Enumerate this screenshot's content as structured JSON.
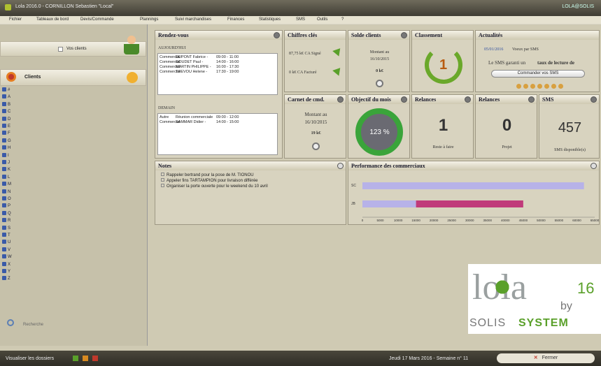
{
  "window": {
    "title": "Lola 2016.0 - CORNILLON Sebastien \"Local\"",
    "user": "LOLA@SOLIS"
  },
  "menu": [
    "Fichier",
    "Tableaux de bord",
    "Devis/Commande",
    "Plannings",
    "Suivi marchandises",
    "Finances",
    "Statistiques",
    "SMS",
    "Outils",
    "?"
  ],
  "sidebar": {
    "viz_label": "Vos clients",
    "clients_label": "Clients",
    "search_placeholder": "Recherche",
    "letters": [
      "#",
      "A",
      "B",
      "C",
      "D",
      "E",
      "F",
      "G",
      "H",
      "I",
      "J",
      "K",
      "L",
      "M",
      "N",
      "O",
      "P",
      "Q",
      "R",
      "S",
      "T",
      "U",
      "V",
      "W",
      "X",
      "Y",
      "Z"
    ]
  },
  "rdv": {
    "title": "Rendez-vous",
    "today": "AUJOURD'HUI",
    "tomorrow": "DEMAIN",
    "today_rows": [
      [
        "Commercial",
        "DUPONT Fabrice -",
        "09:00 - 11:00"
      ],
      [
        "Commercial",
        "GOUDET Paul -",
        "14:00 - 16:00"
      ],
      [
        "Commercial",
        "MARTIN PHILIPPE -",
        "16:00 - 17:30"
      ],
      [
        "Commercial",
        "THEVOU Helene -",
        "17:30 - 19:00"
      ]
    ],
    "tomorrow_rows": [
      [
        "Autre",
        "Réunion commerciale",
        "09:00 - 12:00"
      ],
      [
        "Commercial",
        "SAMMAR Didier -",
        "14:00 - 15:00"
      ]
    ]
  },
  "chiffres": {
    "title": "Chiffres clés",
    "signed": "87,75 k€ CA Signé",
    "billed": "0 k€ CA Facturé"
  },
  "solde": {
    "title": "Solde clients",
    "line1": "Montant au",
    "line2": "16/10/2015",
    "value": "0 k€"
  },
  "classement": {
    "title": "Classement",
    "rank": "1"
  },
  "actu": {
    "title": "Actualités",
    "date": "05/01/2016",
    "headline": "Voeux par SMS",
    "text1": "Le SMS garanti un",
    "text2": "taux de lecture de",
    "button": "Commander vos SMS"
  },
  "carnet": {
    "title": "Carnet de cmd.",
    "line1": "Montant au",
    "line2": "16/10/2015",
    "value": "19 k€"
  },
  "objectif": {
    "title": "Objectif du mois",
    "value": "123 %"
  },
  "relances1": {
    "title": "Relances",
    "value": "1",
    "label": "Reste à faire"
  },
  "relances2": {
    "title": "Relances",
    "value": "0",
    "label": "Projet"
  },
  "sms": {
    "title": "SMS",
    "value": "457",
    "label": "SMS disponible(s)"
  },
  "notes": {
    "title": "Notes",
    "items": [
      "Rappeler bertrand pour la pose de M. TIONOU",
      "Appeler fins TARTAMPION pour livraison différée",
      "Organiser la porte ouverte pour le weekend du 10 avril"
    ]
  },
  "perf": {
    "title": "Performance des commerciaux"
  },
  "logo": {
    "text": "lola",
    "version": "16",
    "by": "by",
    "brand": "SOLIS",
    "brand2": "SYSTEM"
  },
  "footer": {
    "left": "Visualiser les dossiers",
    "date": "Jeudi 17 Mars 2016 - Semaine n° 11",
    "close": "Fermer"
  },
  "chart_data": {
    "type": "bar",
    "categories": [
      "SC",
      "JB"
    ],
    "series": [
      {
        "values": [
          62000,
          15000
        ]
      },
      {
        "values": [
          0,
          30000
        ]
      }
    ],
    "ticks": [
      "0",
      "5000",
      "10000",
      "15000",
      "20000",
      "25000",
      "30000",
      "35000",
      "40000",
      "45000",
      "50000",
      "55000",
      "60000",
      "65000"
    ],
    "xlim": [
      0,
      65000
    ],
    "colors": [
      "#b7b2e8",
      "#c03a7a"
    ]
  }
}
